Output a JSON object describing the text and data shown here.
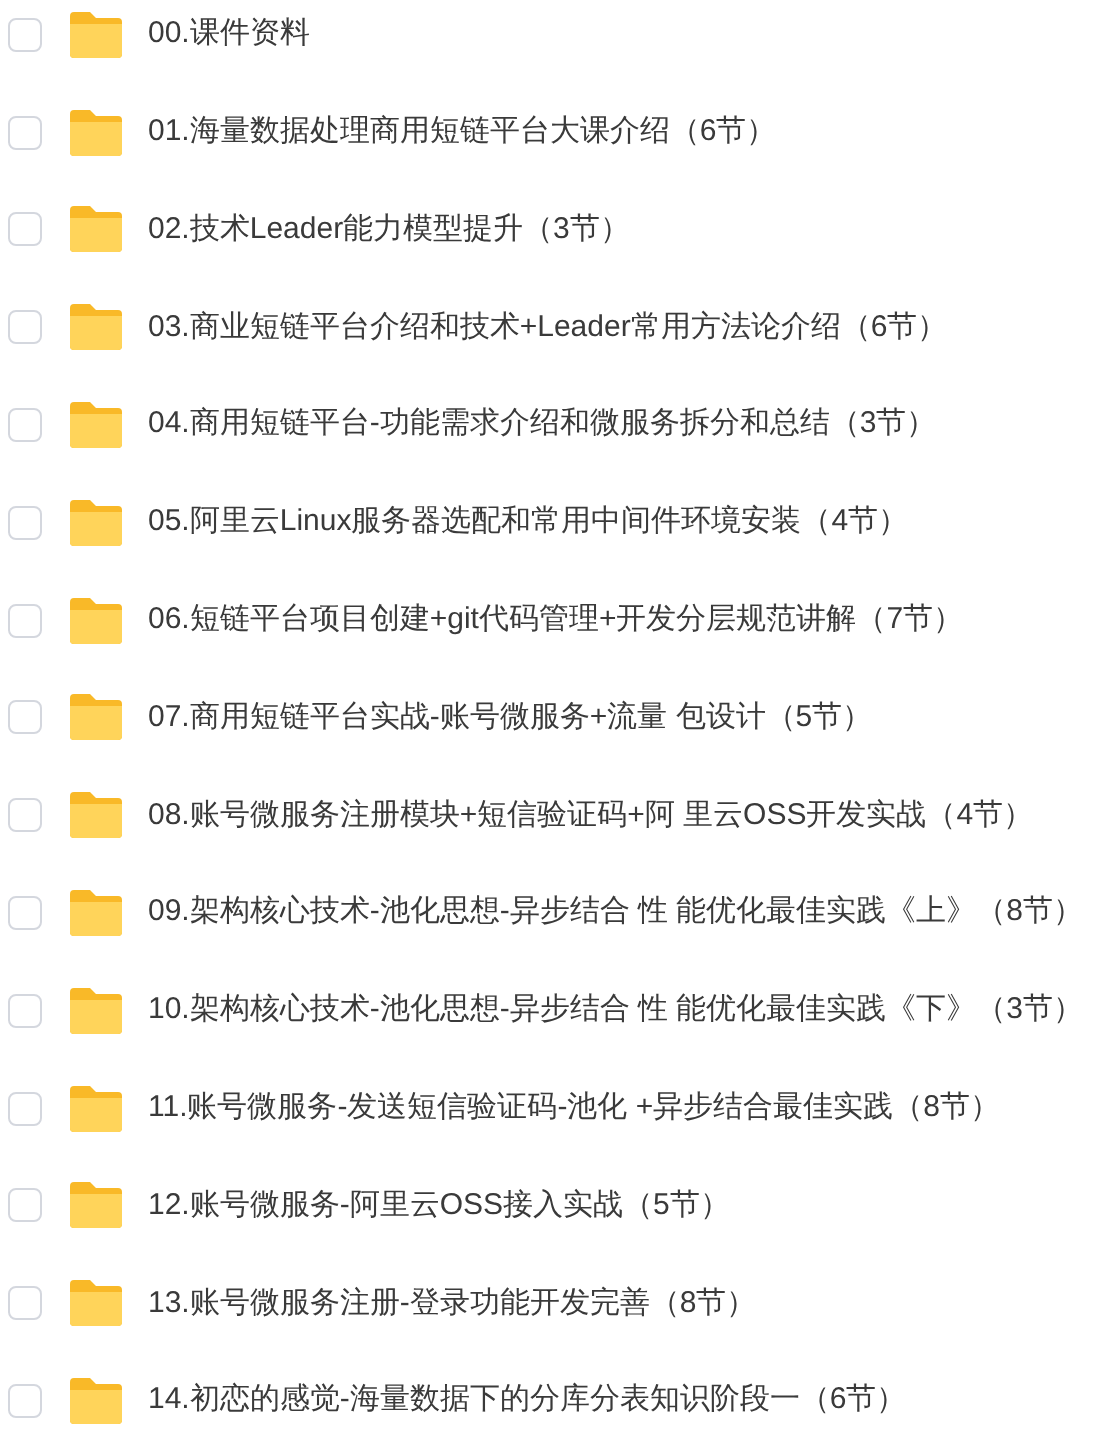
{
  "files": [
    {
      "name": "00.课件资料",
      "checked": false
    },
    {
      "name": "01.海量数据处理商用短链平台大课介绍（6节）",
      "checked": false
    },
    {
      "name": "02.技术Leader能力模型提升（3节）",
      "checked": false
    },
    {
      "name": "03.商业短链平台介绍和技术+Leader常用方法论介绍（6节）",
      "checked": false
    },
    {
      "name": "04.商用短链平台-功能需求介绍和微服务拆分和总结（3节）",
      "checked": false
    },
    {
      "name": "05.阿里云Linux服务器选配和常用中间件环境安装（4节）",
      "checked": false
    },
    {
      "name": "06.短链平台项目创建+git代码管理+开发分层规范讲解（7节）",
      "checked": false
    },
    {
      "name": "07.商用短链平台实战-账号微服务+流量 包设计（5节）",
      "checked": false
    },
    {
      "name": "08.账号微服务注册模块+短信验证码+阿 里云OSS开发实战（4节）",
      "checked": false
    },
    {
      "name": "09.架构核心技术-池化思想-异步结合 性 能优化最佳实践《上》（8节）",
      "checked": false
    },
    {
      "name": "10.架构核心技术-池化思想-异步结合 性 能优化最佳实践《下》（3节）",
      "checked": false
    },
    {
      "name": "11.账号微服务-发送短信验证码-池化 +异步结合最佳实践（8节）",
      "checked": false
    },
    {
      "name": "12.账号微服务-阿里云OSS接入实战（5节）",
      "checked": false
    },
    {
      "name": "13.账号微服务注册-登录功能开发完善（8节）",
      "checked": false
    },
    {
      "name": "14.初恋的感觉-海量数据下的分库分表知识阶段一（6节）",
      "checked": false
    }
  ]
}
